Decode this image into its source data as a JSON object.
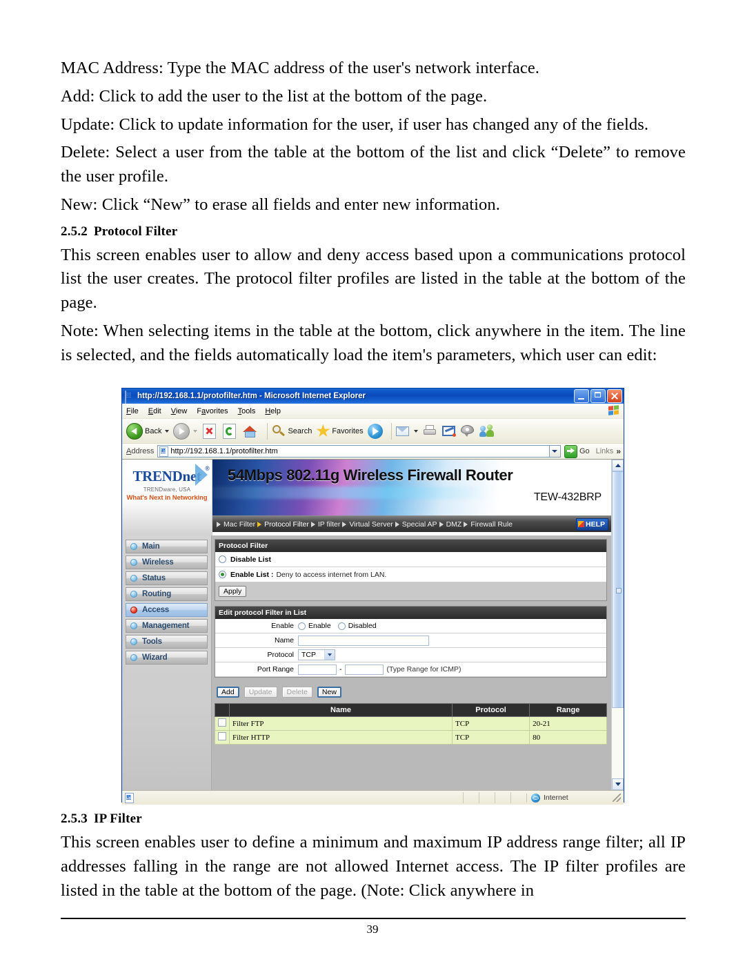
{
  "document": {
    "paragraphs": [
      "MAC Address: Type the MAC address of the user's network interface.",
      "Add: Click to add the user to the list at the bottom of the page.",
      "Update: Click to update information for the user, if user has changed any of the fields.",
      "Delete: Select a user from the table at the bottom of the list and click “Delete” to remove the user profile.",
      "New: Click “New” to erase all fields and enter new information."
    ],
    "section_252": {
      "number": "2.5.2",
      "title": "Protocol Filter",
      "body": "This screen enables user to allow and deny access based upon a communications protocol list the user creates. The protocol filter profiles are listed in the table at the bottom of the page.",
      "note": "Note: When selecting items in the table at the bottom, click anywhere in the item. The line is selected, and the fields automatically load the item's parameters, which user can edit:"
    },
    "section_253": {
      "number": "2.5.3",
      "title": "IP Filter",
      "body": "This screen enables user to define a minimum and maximum IP address range filter; all IP addresses falling in the range are not allowed Internet access.  The IP filter profiles are listed in the table at the bottom of the page. (Note: Click anywhere in"
    },
    "page_number": "39"
  },
  "browser": {
    "title": "http://192.168.1.1/protofilter.htm - Microsoft Internet Explorer",
    "menu": [
      "File",
      "Edit",
      "View",
      "Favorites",
      "Tools",
      "Help"
    ],
    "toolbar": {
      "back": "Back",
      "search": "Search",
      "favorites": "Favorites"
    },
    "address": {
      "label": "Address",
      "url": "http://192.168.1.1/protofilter.htm",
      "go": "Go",
      "links": "Links",
      "overflow": "»"
    },
    "status": {
      "zone": "Internet"
    }
  },
  "router": {
    "brand": {
      "name_main": "TRENDnet",
      "registered": "®",
      "sub1": "TRENDware, USA",
      "sub2": "What's Next in Networking"
    },
    "banner": {
      "title": "54Mbps 802.11g Wireless Firewall Router",
      "model": "TEW-432BRP"
    },
    "nav": [
      {
        "label": "Mac Filter",
        "active": false
      },
      {
        "label": "Protocol Filter",
        "active": true
      },
      {
        "label": "IP filter",
        "active": false
      },
      {
        "label": "Virtual Server",
        "active": false
      },
      {
        "label": "Special AP",
        "active": false
      },
      {
        "label": "DMZ",
        "active": false
      },
      {
        "label": "Firewall Rule",
        "active": false
      }
    ],
    "help_label": "HELP",
    "sidebar": [
      {
        "label": "Main",
        "selected": false
      },
      {
        "label": "Wireless",
        "selected": false
      },
      {
        "label": "Status",
        "selected": false
      },
      {
        "label": "Routing",
        "selected": false
      },
      {
        "label": "Access",
        "selected": true
      },
      {
        "label": "Management",
        "selected": false
      },
      {
        "label": "Tools",
        "selected": false
      },
      {
        "label": "Wizard",
        "selected": false
      }
    ],
    "protocol_filter_panel": {
      "header": "Protocol Filter",
      "disable_list": "Disable List",
      "enable_list_label": "Enable List :",
      "enable_list_note": "Deny to access internet from LAN.",
      "apply": "Apply"
    },
    "edit_panel": {
      "header": "Edit protocol Filter in List",
      "enable_label": "Enable",
      "enable_option": "Enable",
      "disabled_option": "Disabled",
      "name_label": "Name",
      "name_value": "",
      "protocol_label": "Protocol",
      "protocol_value": "TCP",
      "port_range_label": "Port Range",
      "port_start": "",
      "port_end": "",
      "port_sep": "-",
      "port_hint": "(Type Range for ICMP)"
    },
    "buttons": {
      "add": "Add",
      "update": "Update",
      "delete": "Delete",
      "new": "New"
    },
    "table": {
      "columns": [
        "Name",
        "Protocol",
        "Range"
      ],
      "rows": [
        {
          "name": "Filter FTP",
          "protocol": "TCP",
          "range": "20-21"
        },
        {
          "name": "Filter HTTP",
          "protocol": "TCP",
          "range": "80"
        }
      ]
    }
  }
}
